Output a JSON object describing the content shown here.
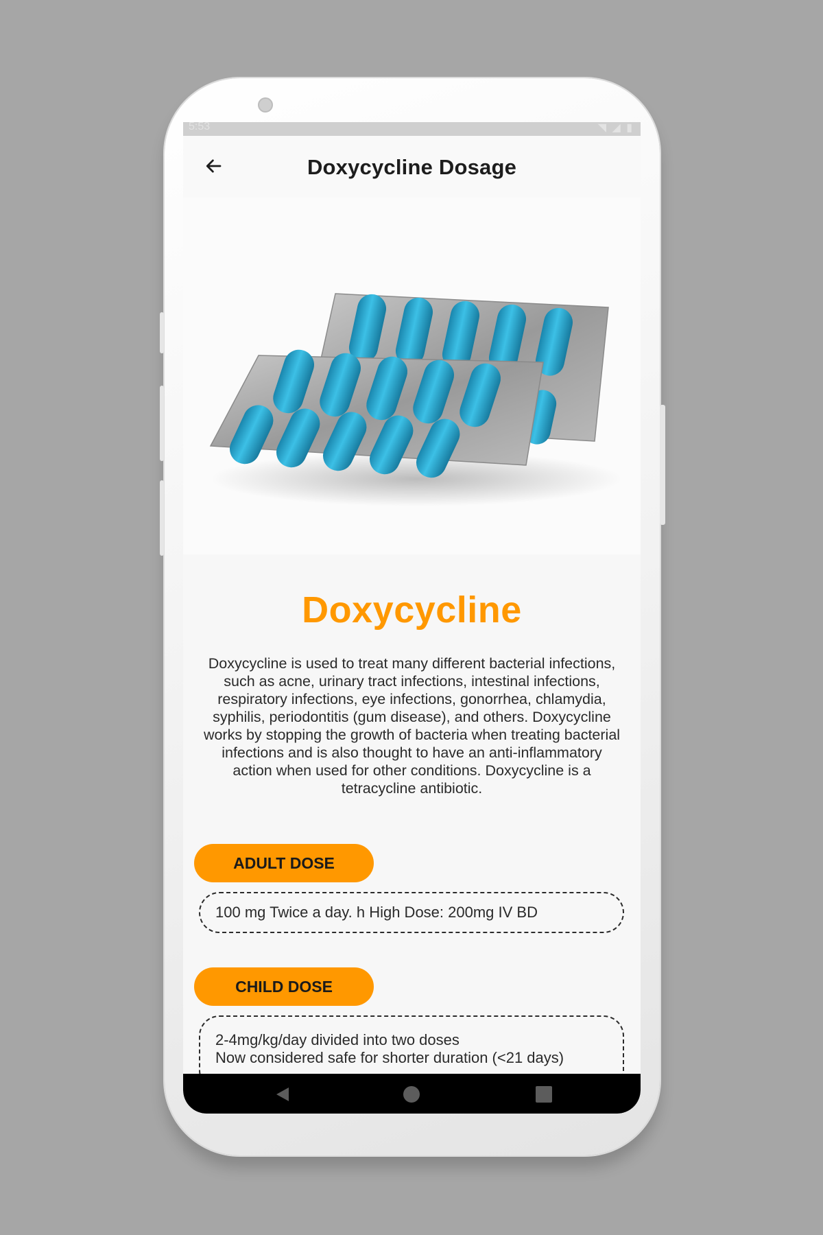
{
  "status_bar": {
    "time": "5:53",
    "icons": "◥ ◢ ▮"
  },
  "app_bar": {
    "title": "Doxycycline Dosage",
    "back_icon": "arrow-left-icon"
  },
  "hero": {
    "image": "blister-pack-capsules",
    "capsule_color": "#2aa6cf"
  },
  "drug": {
    "name": "Doxycycline",
    "description": "Doxycycline is used to treat many different bacterial infections, such as acne, urinary tract infections, intestinal infections, respiratory infections, eye infections, gonorrhea, chlamydia, syphilis, periodontitis (gum disease), and others. Doxycycline works by stopping the growth of bacteria when treating bacterial infections and is also thought to have an anti-inflammatory action when used for other conditions. Doxycycline is a tetracycline antibiotic."
  },
  "adult": {
    "label": "ADULT DOSE",
    "text": "100 mg Twice a day. h High Dose: 200mg IV BD"
  },
  "child": {
    "label": "CHILD DOSE",
    "line1": "2-4mg/kg/day divided into two doses",
    "line2": "Now considered safe for shorter duration (<21 days)"
  },
  "nav": {
    "back": "nav-back-icon",
    "home": "nav-home-icon",
    "recents": "nav-recents-icon"
  },
  "colors": {
    "accent": "#ff9800",
    "background": "#a6a6a6",
    "nav": "#000000"
  }
}
